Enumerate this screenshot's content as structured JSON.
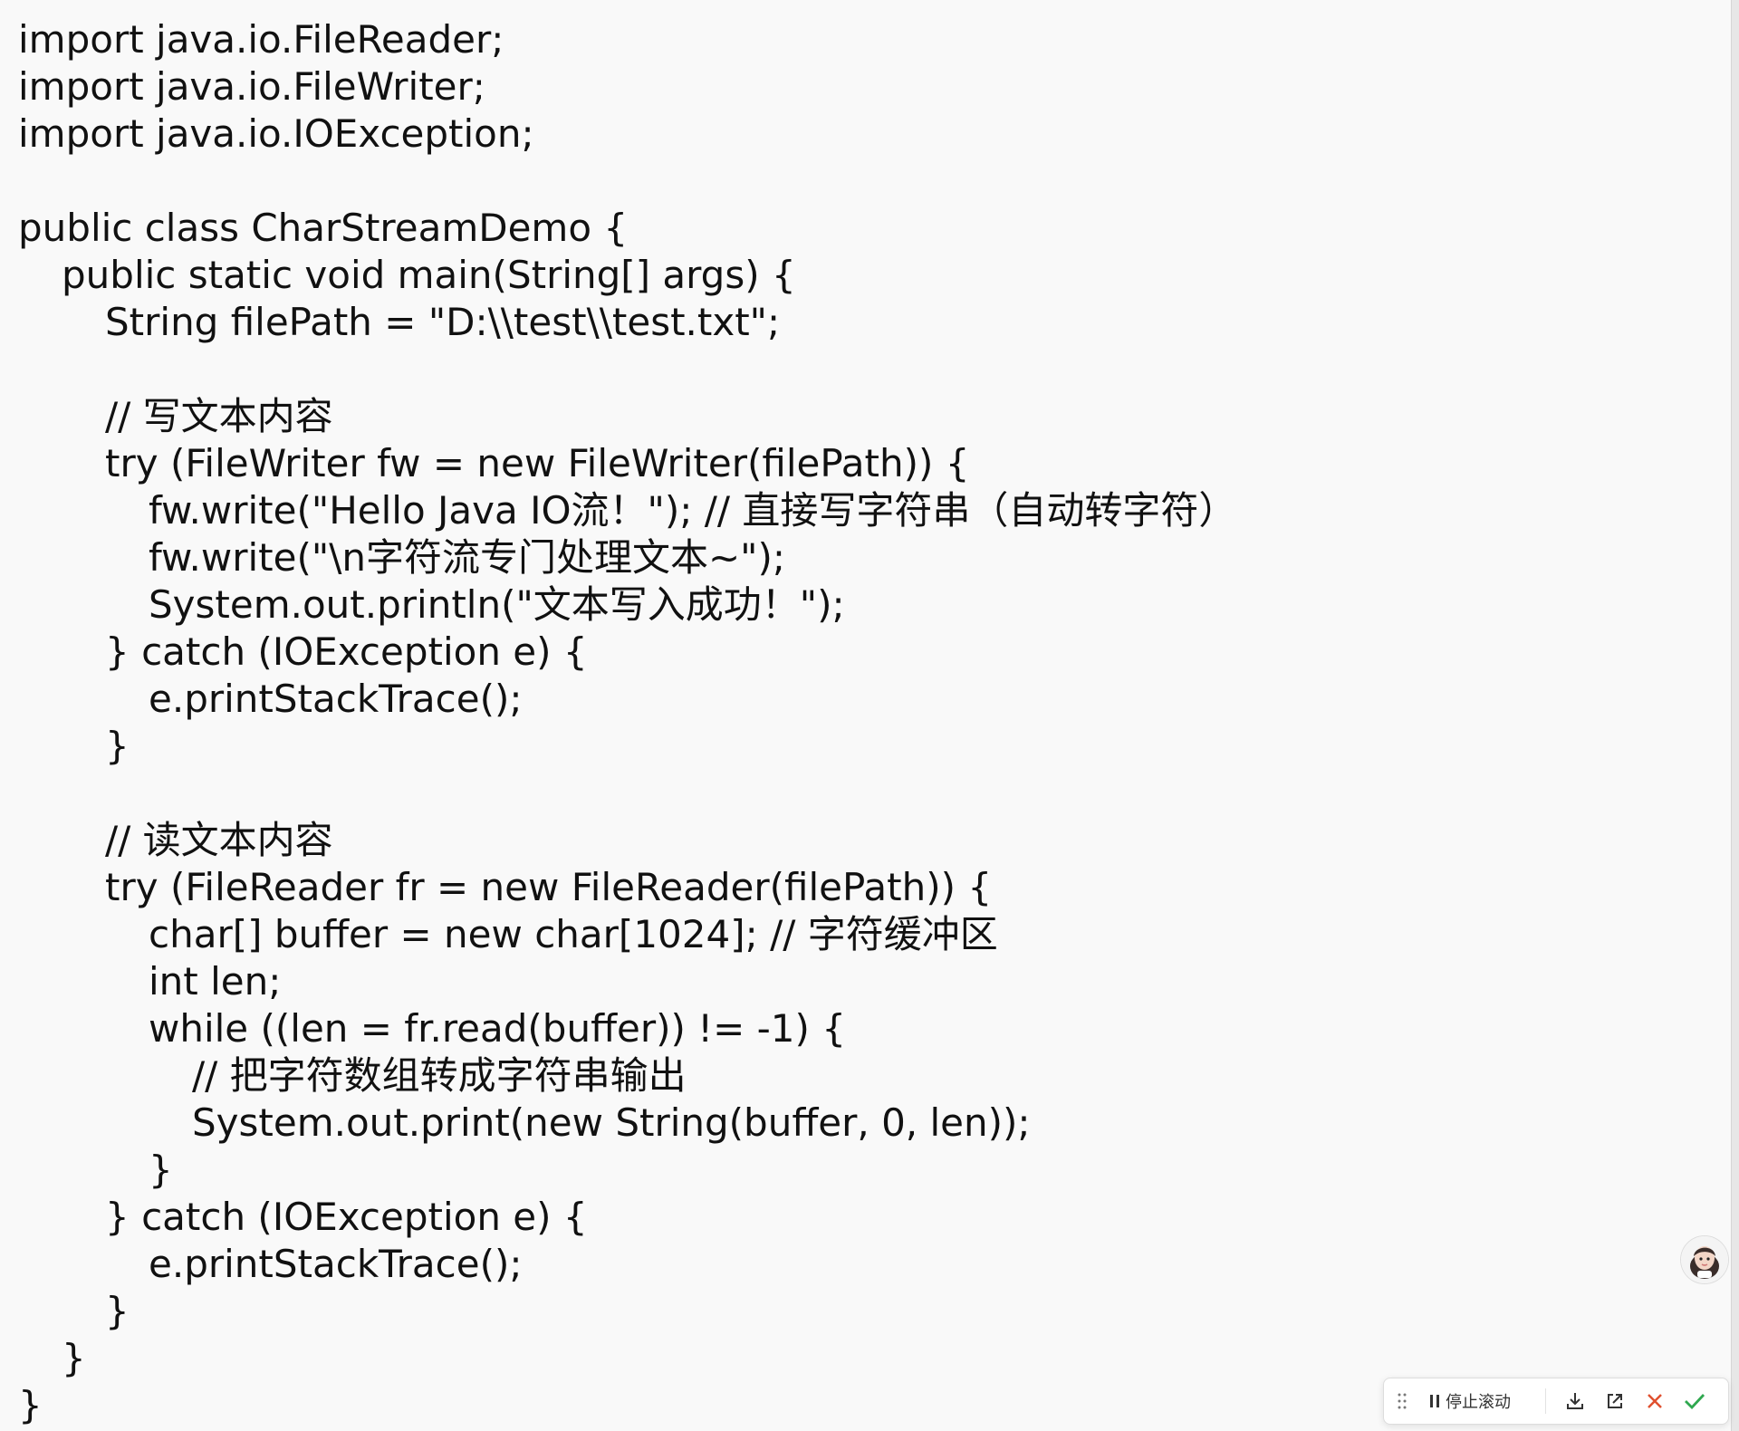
{
  "code": {
    "lines": [
      {
        "text": "import java.io.FileReader;",
        "indent": 0
      },
      {
        "text": "import java.io.FileWriter;",
        "indent": 0
      },
      {
        "text": "import java.io.IOException;",
        "indent": 0
      },
      {
        "text": "",
        "indent": 0
      },
      {
        "text": "public class CharStreamDemo {",
        "indent": 0
      },
      {
        "text": "public static void main(String[] args) {",
        "indent": 1
      },
      {
        "text": "String filePath = \"D:\\\\test\\\\test.txt\";",
        "indent": 2
      },
      {
        "text": "",
        "indent": 0
      },
      {
        "text": "// 写文本内容",
        "indent": 2
      },
      {
        "text": "try (FileWriter fw = new FileWriter(filePath)) {",
        "indent": 2
      },
      {
        "text": "fw.write(\"Hello Java IO流！\"); // 直接写字符串（自动转字符）",
        "indent": 3
      },
      {
        "text": "fw.write(\"\\n字符流专门处理文本~\");",
        "indent": 3
      },
      {
        "text": "System.out.println(\"文本写入成功！\");",
        "indent": 3
      },
      {
        "text": "} catch (IOException e) {",
        "indent": 2
      },
      {
        "text": "e.printStackTrace();",
        "indent": 3
      },
      {
        "text": "}",
        "indent": 2
      },
      {
        "text": "",
        "indent": 0
      },
      {
        "text": "// 读文本内容",
        "indent": 2
      },
      {
        "text": "try (FileReader fr = new FileReader(filePath)) {",
        "indent": 2
      },
      {
        "text": "char[] buffer = new char[1024]; // 字符缓冲区",
        "indent": 3
      },
      {
        "text": "int len;",
        "indent": 3
      },
      {
        "text": "while ((len = fr.read(buffer)) != -1) {",
        "indent": 3
      },
      {
        "text": "// 把字符数组转成字符串输出",
        "indent": 4
      },
      {
        "text": "System.out.print(new String(buffer, 0, len));",
        "indent": 4
      },
      {
        "text": "}",
        "indent": 3
      },
      {
        "text": "} catch (IOException e) {",
        "indent": 2
      },
      {
        "text": "e.printStackTrace();",
        "indent": 3
      },
      {
        "text": "}",
        "indent": 2
      },
      {
        "text": "}",
        "indent": 1
      },
      {
        "text": "}",
        "indent": 0
      }
    ]
  },
  "toolbar": {
    "stop_scroll_label": "停止滚动",
    "icons": {
      "drag": "drag-handle-icon",
      "pause": "pause-icon",
      "download": "download-icon",
      "open_external": "open-external-icon",
      "cancel": "close-icon",
      "confirm": "check-icon"
    },
    "colors": {
      "cancel": "#e0502f",
      "confirm": "#2fa84f"
    }
  },
  "assistant": {
    "icon": "assistant-avatar-icon"
  }
}
